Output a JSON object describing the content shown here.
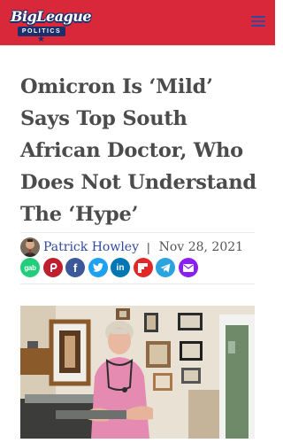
{
  "header": {
    "logo_text": "BigLeague",
    "logo_subtext": "POLITICS",
    "background_color": "#d9283a",
    "menu_icon": "hamburger-icon"
  },
  "article": {
    "title": "Omicron Is ‘Mild’ Says Top South African Doctor, Who Does Not Understand The ‘Hype’",
    "author": "Patrick Howley",
    "separator": "|",
    "date": "Nov 28, 2021"
  },
  "share": {
    "buttons": [
      {
        "name": "gab",
        "label": "gab",
        "color": "#21cf7a"
      },
      {
        "name": "parler",
        "icon": "parler-icon",
        "color": "#be1e2d"
      },
      {
        "name": "facebook",
        "label": "f",
        "color": "#3b5998"
      },
      {
        "name": "twitter",
        "icon": "twitter-bird-icon",
        "color": "#1da1f2"
      },
      {
        "name": "linkedin",
        "label": "in",
        "color": "#0077b5"
      },
      {
        "name": "flipboard",
        "icon": "flipboard-icon",
        "color": "#e12828"
      },
      {
        "name": "telegram",
        "icon": "paper-plane-icon",
        "color": "#2aa3de"
      },
      {
        "name": "email",
        "icon": "envelope-icon",
        "color": "#8b1ff2"
      }
    ]
  }
}
